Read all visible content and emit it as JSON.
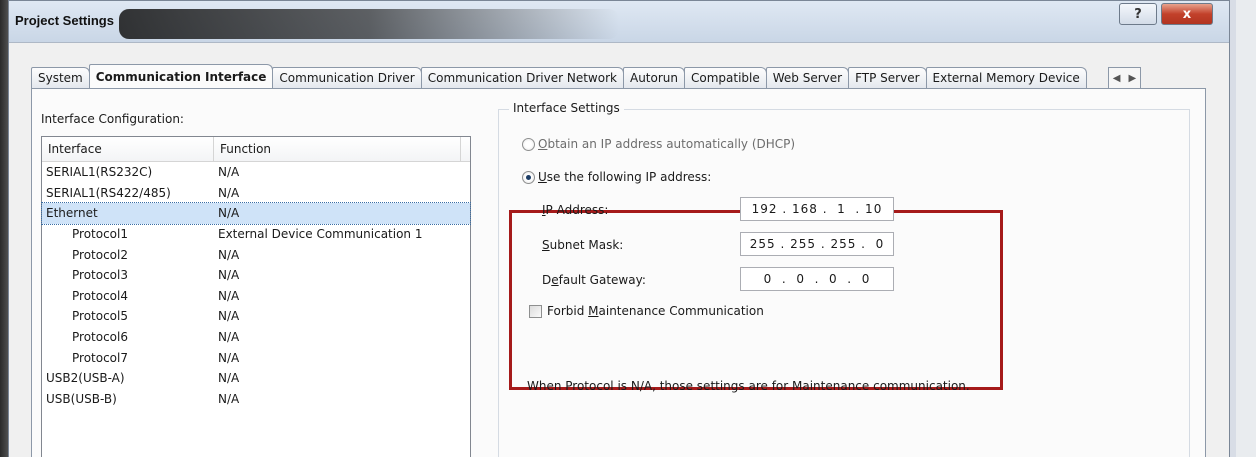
{
  "window": {
    "title": "Project Settings",
    "help_label": "?",
    "close_label": "x"
  },
  "tabs": [
    {
      "label": "System"
    },
    {
      "label": "Communication Interface",
      "active": true
    },
    {
      "label": "Communication Driver"
    },
    {
      "label": "Communication Driver Network"
    },
    {
      "label": "Autorun"
    },
    {
      "label": "Compatible"
    },
    {
      "label": "Web Server"
    },
    {
      "label": "FTP Server"
    },
    {
      "label": "External Memory Device"
    }
  ],
  "tab_scroll": {
    "left": "◀",
    "right": "▶"
  },
  "interface_config": {
    "label": "Interface Configuration:",
    "columns": [
      "Interface",
      "Function"
    ],
    "rows": [
      {
        "interface": "SERIAL1(RS232C)",
        "function": "N/A"
      },
      {
        "interface": "SERIAL1(RS422/485)",
        "function": "N/A"
      },
      {
        "interface": "Ethernet",
        "function": "N/A",
        "selected": true
      },
      {
        "interface": "Protocol1",
        "function": "External Device Communication 1",
        "indent": true
      },
      {
        "interface": "Protocol2",
        "function": "N/A",
        "indent": true
      },
      {
        "interface": "Protocol3",
        "function": "N/A",
        "indent": true
      },
      {
        "interface": "Protocol4",
        "function": "N/A",
        "indent": true
      },
      {
        "interface": "Protocol5",
        "function": "N/A",
        "indent": true
      },
      {
        "interface": "Protocol6",
        "function": "N/A",
        "indent": true
      },
      {
        "interface": "Protocol7",
        "function": "N/A",
        "indent": true
      },
      {
        "interface": "USB2(USB-A)",
        "function": "N/A"
      },
      {
        "interface": "USB(USB-B)",
        "function": "N/A"
      }
    ]
  },
  "interface_settings": {
    "title": "Interface Settings",
    "dhcp_label": "Obtain an IP address automatically (DHCP)",
    "dhcp_access": "O",
    "dhcp_rest": "btain an IP address automatically (DHCP)",
    "static_access": "U",
    "static_rest": "se the following IP address:",
    "ip_label_access": "I",
    "ip_label_rest": "P Address:",
    "ip_value": "192 . 168 .  1  . 10",
    "subnet_label_access": "S",
    "subnet_label_rest": "ubnet Mask:",
    "subnet_value": "255 . 255 . 255 .  0",
    "gateway_label_pre": "D",
    "gateway_label_access": "e",
    "gateway_label_rest": "fault Gateway:",
    "gateway_value": "0  .  0  .  0  .  0",
    "forbid_pre": "Forbid ",
    "forbid_access": "M",
    "forbid_rest": "aintenance Communication",
    "note": "When Protocol is N/A, those settings are for Maintenance communication."
  },
  "colors": {
    "highlight_box": "#a51a1a",
    "selected_row": "#cfe3f8",
    "close_button": "#c2412b"
  }
}
